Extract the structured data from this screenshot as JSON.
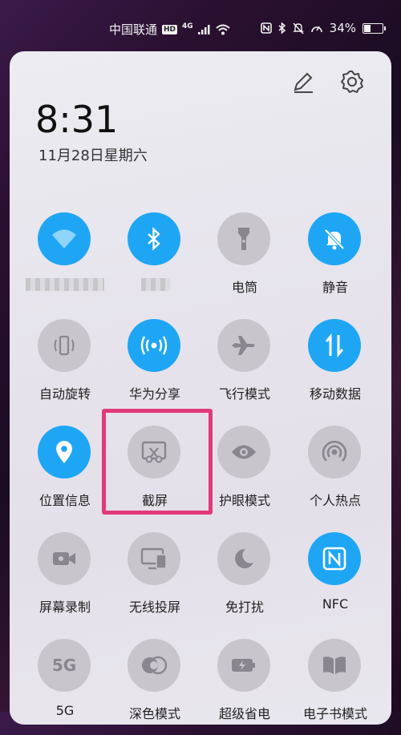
{
  "status_bar": {
    "carrier": "中国联通",
    "hd": "HD",
    "network": "4G",
    "battery_percent": "34%",
    "battery_level": 0.34
  },
  "panel": {
    "time": "8:31",
    "date": "11月28日星期六",
    "edit_icon": "pencil-icon",
    "settings_icon": "gear-icon"
  },
  "tiles": [
    {
      "label": "",
      "icon": "wifi-icon",
      "state": "on"
    },
    {
      "label": "",
      "icon": "bluetooth-icon",
      "state": "on"
    },
    {
      "label": "电筒",
      "icon": "flashlight-icon",
      "state": "off"
    },
    {
      "label": "静音",
      "icon": "bell-mute-icon",
      "state": "on"
    },
    {
      "label": "自动旋转",
      "icon": "rotate-icon",
      "state": "off"
    },
    {
      "label": "华为分享",
      "icon": "share-icon",
      "state": "on"
    },
    {
      "label": "飞行模式",
      "icon": "airplane-icon",
      "state": "off"
    },
    {
      "label": "移动数据",
      "icon": "mobile-data-icon",
      "state": "on"
    },
    {
      "label": "位置信息",
      "icon": "location-icon",
      "state": "on"
    },
    {
      "label": "截屏",
      "icon": "screenshot-icon",
      "state": "off"
    },
    {
      "label": "护眼模式",
      "icon": "eye-icon",
      "state": "off"
    },
    {
      "label": "个人热点",
      "icon": "hotspot-icon",
      "state": "off"
    },
    {
      "label": "屏幕录制",
      "icon": "screen-record-icon",
      "state": "off"
    },
    {
      "label": "无线投屏",
      "icon": "cast-icon",
      "state": "off"
    },
    {
      "label": "免打扰",
      "icon": "moon-icon",
      "state": "off"
    },
    {
      "label": "NFC",
      "icon": "nfc-icon",
      "state": "on"
    },
    {
      "label": "5G",
      "icon": "5g-icon",
      "state": "off"
    },
    {
      "label": "深色模式",
      "icon": "dark-mode-icon",
      "state": "off"
    },
    {
      "label": "超级省电",
      "icon": "battery-saver-icon",
      "state": "off"
    },
    {
      "label": "电子书模式",
      "icon": "book-icon",
      "state": "off"
    }
  ],
  "five_g_text": "5G",
  "highlight_color": "#e2397a",
  "active_color": "#1ea6f5"
}
